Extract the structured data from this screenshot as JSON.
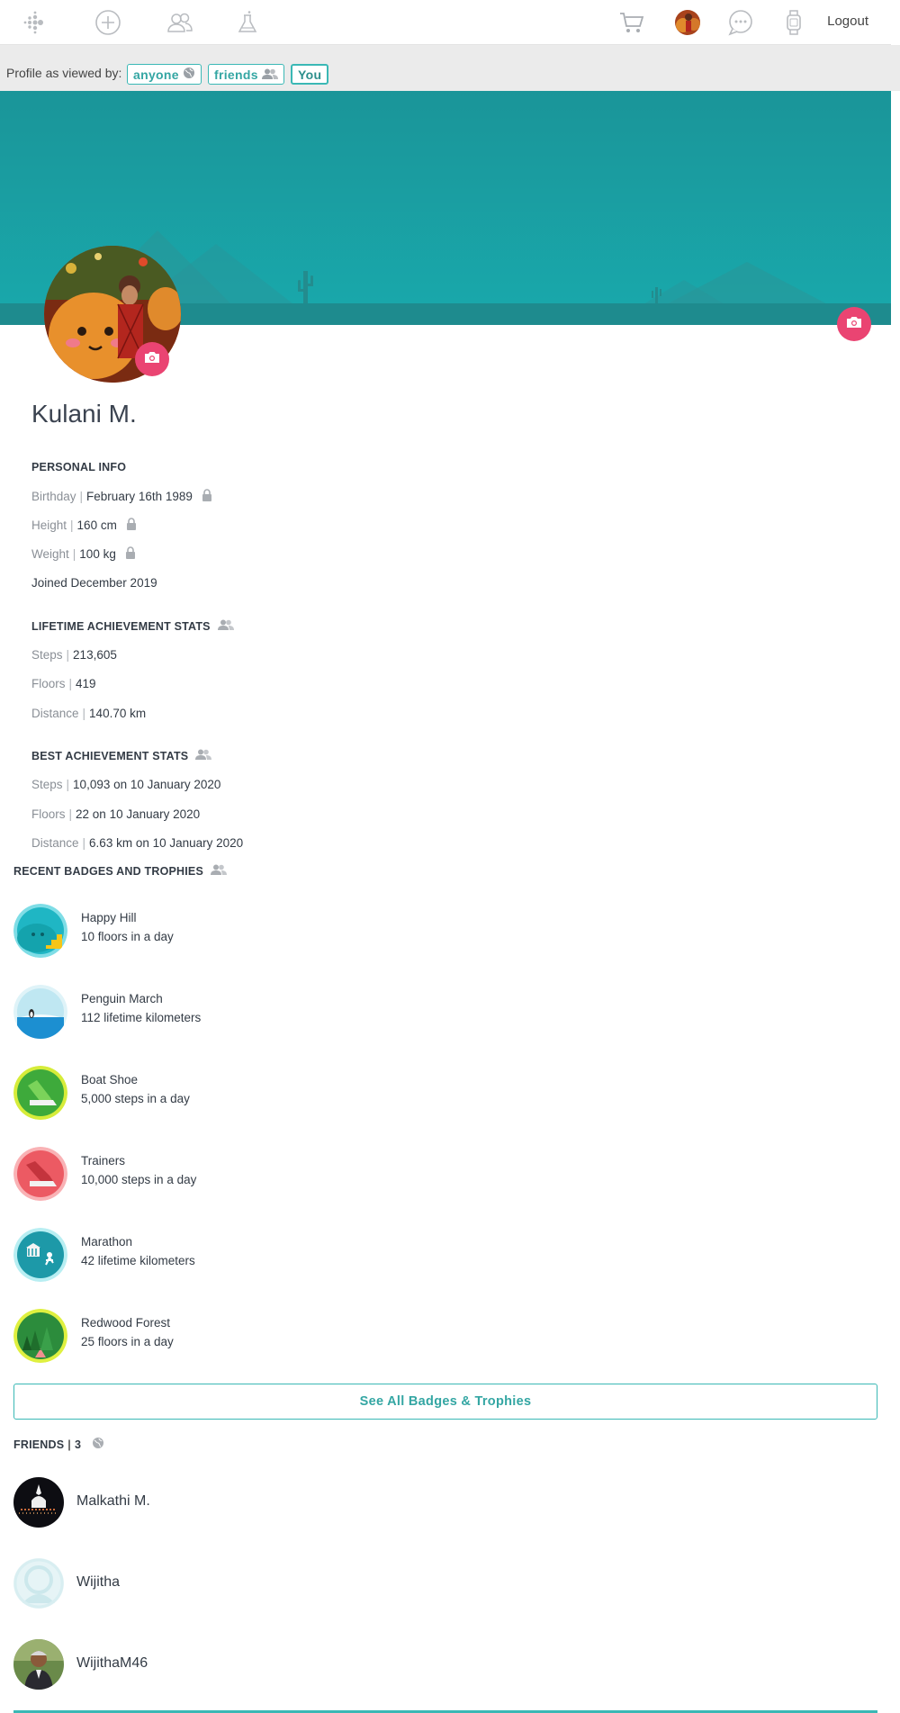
{
  "nav": {
    "icons": [
      "fitbit-logo-icon",
      "add-icon",
      "community-icon",
      "labs-icon",
      "cart-icon",
      "user-avatar",
      "messages-icon",
      "device-icon"
    ],
    "logout_label": "Logout"
  },
  "view_bar": {
    "label": "Profile as viewed by:",
    "options": [
      "anyone",
      "friends",
      "You"
    ],
    "selected": "You"
  },
  "profile": {
    "name": "Kulani M."
  },
  "personal_info": {
    "heading": "PERSONAL INFO",
    "birthday_label": "Birthday",
    "birthday_value": "February 16th 1989",
    "height_label": "Height",
    "height_value": "160 cm",
    "weight_label": "Weight",
    "weight_value": "100 kg",
    "joined": "Joined December 2019"
  },
  "lifetime_stats": {
    "heading": "LIFETIME ACHIEVEMENT STATS",
    "steps_label": "Steps",
    "steps_value": "213,605",
    "floors_label": "Floors",
    "floors_value": "419",
    "distance_label": "Distance",
    "distance_value": "140.70 km"
  },
  "best_stats": {
    "heading": "BEST ACHIEVEMENT STATS",
    "steps_label": "Steps",
    "steps_value": "10,093 on 10 January 2020",
    "floors_label": "Floors",
    "floors_value": "22 on 10 January 2020",
    "distance_label": "Distance",
    "distance_value": "6.63 km on 10 January 2020"
  },
  "badges": {
    "heading": "RECENT BADGES AND TROPHIES",
    "items": [
      {
        "name": "Happy Hill",
        "desc": "10 floors in a day",
        "color": "#1fb6c4"
      },
      {
        "name": "Penguin March",
        "desc": "112 lifetime kilometers",
        "color": "#bfe7f2"
      },
      {
        "name": "Boat Shoe",
        "desc": "5,000 steps in a day",
        "color": "#b6d829"
      },
      {
        "name": "Trainers",
        "desc": "10,000 steps in a day",
        "color": "#f27f86"
      },
      {
        "name": "Marathon",
        "desc": "42 lifetime kilometers",
        "color": "#2bb5c4"
      },
      {
        "name": "Redwood Forest",
        "desc": "25 floors in a day",
        "color": "#c4dd2a"
      }
    ],
    "see_all_label": "See All Badges & Trophies"
  },
  "friends": {
    "heading_label": "FRIENDS",
    "count": "3",
    "items": [
      {
        "name": "Malkathi M."
      },
      {
        "name": "Wijitha"
      },
      {
        "name": "WijithaM46"
      }
    ]
  },
  "colors": {
    "accent": "#3ab8b5",
    "banner": "#1a9fa3",
    "camera": "#ea4472"
  }
}
